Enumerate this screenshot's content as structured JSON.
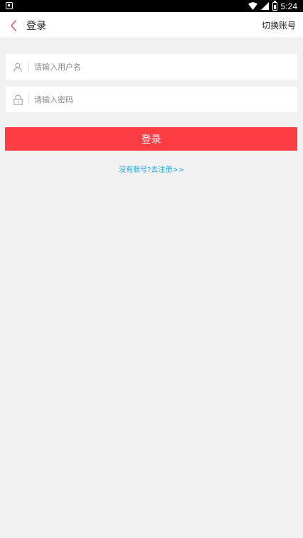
{
  "status_bar": {
    "time": "5:24"
  },
  "header": {
    "title": "登录",
    "switch_account": "切换账号"
  },
  "form": {
    "username_placeholder": "请输入用户名",
    "password_placeholder": "请输入密码",
    "login_label": "登录",
    "register_link": "没有账号?去注册>>"
  },
  "colors": {
    "accent": "#fc3e44",
    "link": "#21a7e8",
    "back_icon": "#e8537a",
    "background": "#f1f1f1"
  },
  "icons": {
    "back": "chevron-left-icon",
    "username": "user-icon",
    "password": "lock-icon"
  }
}
